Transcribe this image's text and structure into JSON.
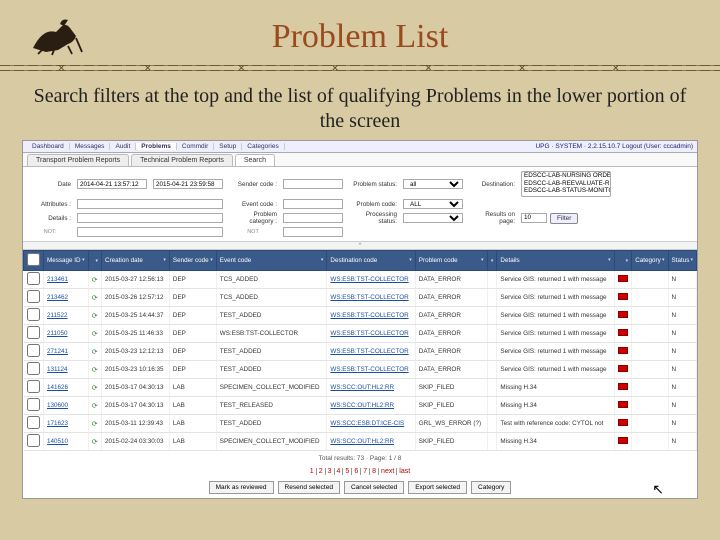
{
  "slide": {
    "title": "Problem List",
    "subtitle": "Search filters at the top and the list of qualifying Problems in the lower portion of the screen"
  },
  "topTabs": {
    "items": [
      "Dashboard",
      "Messages",
      "Audit",
      "Problems",
      "Commdir",
      "Setup",
      "Categories"
    ],
    "activeIndex": 3,
    "right": "UPG · SYSTEM · 2.2.15.10.7   Logout (User: cccadmin)"
  },
  "subTabs": {
    "items": [
      "Transport Problem Reports",
      "Technical Problem Reports",
      "Search"
    ],
    "activeIndex": 2
  },
  "filters": {
    "date": {
      "label": "Date",
      "from": "2014-04-21 13:57:12",
      "to": "2015-04-21 23:59:58"
    },
    "attributes": {
      "label": "Attributes :",
      "value": "",
      "not": "NOT:"
    },
    "details": {
      "label": "Details :",
      "value": "",
      "not": "NOT:"
    },
    "sender": {
      "label": "Sender code :",
      "value": "",
      "not": "NOT"
    },
    "event": {
      "label": "Event code :",
      "value": "",
      "not": "NOT"
    },
    "problemCategory": {
      "label": "Problem category :",
      "value": "",
      "not": "NOT"
    },
    "problemStatus": {
      "label": "Problem status:",
      "value": "all"
    },
    "problemCode": {
      "label": "Problem code:",
      "value": "ALL"
    },
    "processingStatus": {
      "label": "Processing status:",
      "value": ""
    },
    "destination": {
      "label": "Destination:",
      "options": [
        "EDSCC-LAB-NURSING ORDER ENTRY",
        "EDSCC-LAB-REEVALUATE-RESULTS",
        "EDSCC-LAB-STATUS-MONITOR"
      ]
    },
    "resultsOnPage": {
      "label": "Results on page:",
      "value": "10"
    },
    "filterBtn": "Filter"
  },
  "table": {
    "columns": [
      "",
      "Message ID",
      "",
      "Creation date",
      "Sender code",
      "Event code",
      "Destination code",
      "Problem code",
      "",
      "Details",
      "",
      "Category",
      "Status"
    ],
    "rows": [
      {
        "id": "213461",
        "date": "2015-03-27 12:56:13",
        "sender": "DEP",
        "event": "TCS_ADDED",
        "dest": "WS:ESB:TST-COLLECTOR",
        "problem": "DATA_ERROR",
        "details": "Service GIS: returned 1 with message",
        "status": "N"
      },
      {
        "id": "213462",
        "date": "2015-03-26 12:57:12",
        "sender": "DEP",
        "event": "TCS_ADDED",
        "dest": "WS:ESB:TST-COLLECTOR",
        "problem": "DATA_ERROR",
        "details": "Service GIS: returned 1 with message",
        "status": "N"
      },
      {
        "id": "211522",
        "date": "2015-03-25 14:44:37",
        "sender": "DEP",
        "event": "TEST_ADDED",
        "dest": "WS:ESB:TST-COLLECTOR",
        "problem": "DATA_ERROR",
        "details": "Service GIS: returned 1 with message",
        "status": "N"
      },
      {
        "id": "211050",
        "date": "2015-03-25 11:46:33",
        "sender": "DEP",
        "event": "WS:ESB:TST-COLLECTOR",
        "dest": "WS:ESB:TST-COLLECTOR",
        "problem": "DATA_ERROR",
        "details": "Service GIS: returned 1 with message",
        "status": "N"
      },
      {
        "id": "271241",
        "date": "2015-03-23 12:12:13",
        "sender": "DEP",
        "event": "TEST_ADDED",
        "dest": "WS:ESB:TST-COLLECTOR",
        "problem": "DATA_ERROR",
        "details": "Service GIS: returned 1 with message",
        "status": "N"
      },
      {
        "id": "131124",
        "date": "2015-03-23 10:16:35",
        "sender": "DEP",
        "event": "TEST_ADDED",
        "dest": "WS:ESB:TST-COLLECTOR",
        "problem": "DATA_ERROR",
        "details": "Service GIS: returned 1 with message",
        "status": "N"
      },
      {
        "id": "141626",
        "date": "2015-03-17 04:30:13",
        "sender": "LAB",
        "event": "SPECIMEN_COLLECT_MODIFIED",
        "dest": "WS:SCC:OUT:HL2:RR",
        "problem": "SKIP_FILED",
        "details": "Missing H.34",
        "status": "N"
      },
      {
        "id": "130600",
        "date": "2015-03-17 04:30:13",
        "sender": "LAB",
        "event": "TEST_RELEASED",
        "dest": "WS:SCC:OUT:HL2:RR",
        "problem": "SKIP_FILED",
        "details": "Missing H.34",
        "status": "N"
      },
      {
        "id": "171623",
        "date": "2015-03-11 12:39:43",
        "sender": "LAB",
        "event": "TEST_ADDED",
        "dest": "WS:SCC:ESB:DT:ICE-CIS",
        "problem": "GRL_WS_ERROR (?)",
        "details": "Test with reference code: CYTOL not",
        "status": "N"
      },
      {
        "id": "140510",
        "date": "2015-02-24 03:30:03",
        "sender": "LAB",
        "event": "SPECIMEN_COLLECT_MODIFIED",
        "dest": "WS:SCC:OUT:HL2:RR",
        "problem": "SKIP_FILED",
        "details": "Missing H.34",
        "status": "N"
      }
    ]
  },
  "footer": {
    "summary": "Total results: 73 · Page: 1 / 8",
    "pages": [
      "1",
      "2",
      "3",
      "4",
      "5",
      "6",
      "7",
      "8",
      "next",
      "last"
    ],
    "actions": [
      "Mark as reviewed",
      "Resend selected",
      "Cancel selected",
      "Export selected",
      "Category"
    ]
  }
}
